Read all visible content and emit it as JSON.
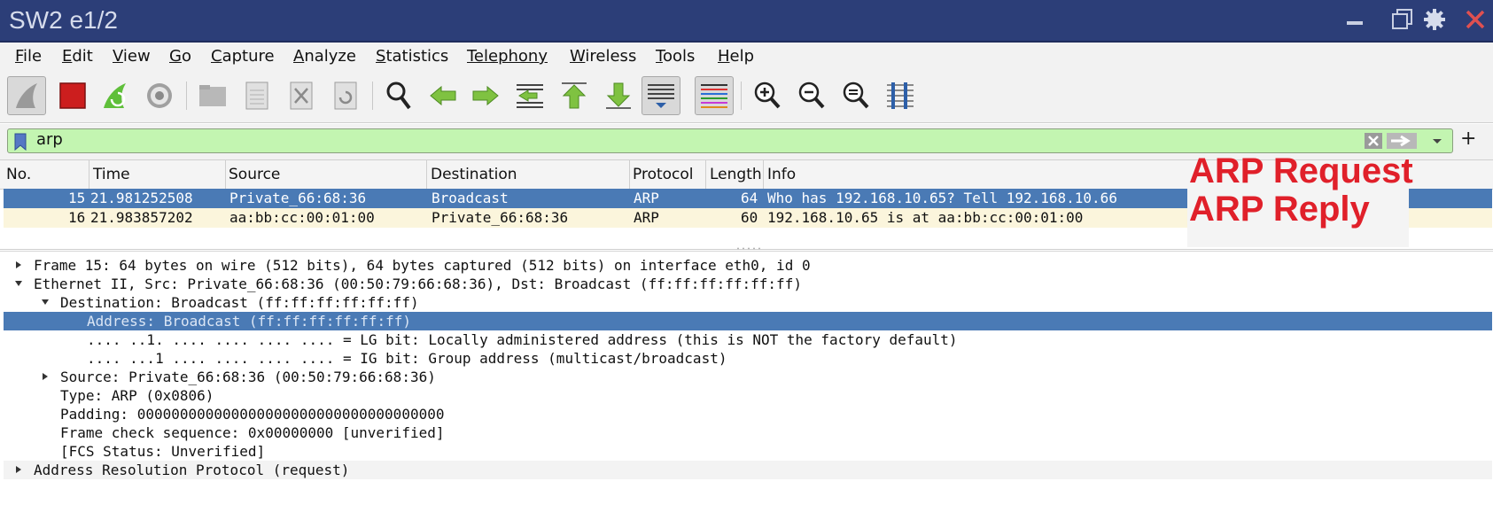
{
  "window": {
    "title": "SW2 e1/2"
  },
  "menu": [
    {
      "label": "File",
      "key": "F",
      "rest": "ile"
    },
    {
      "label": "Edit",
      "key": "E",
      "rest": "dit"
    },
    {
      "label": "View",
      "key": "V",
      "rest": "iew"
    },
    {
      "label": "Go",
      "key": "G",
      "rest": "o"
    },
    {
      "label": "Capture",
      "key": "C",
      "rest": "apture"
    },
    {
      "label": "Analyze",
      "key": "A",
      "rest": "nalyze"
    },
    {
      "label": "Statistics",
      "key": "S",
      "rest": "tatistics"
    },
    {
      "label": "Telephony",
      "key": "",
      "rest": "Telephony"
    },
    {
      "label": "Wireless",
      "key": "W",
      "rest": "ireless"
    },
    {
      "label": "Tools",
      "key": "T",
      "rest": "ools"
    },
    {
      "label": "Help",
      "key": "H",
      "rest": "elp"
    }
  ],
  "toolbar_icons": [
    "shark-fin-icon",
    "stop-icon",
    "restart-icon",
    "options-gear-icon",
    "open-folder-icon",
    "save-file-icon",
    "close-file-icon",
    "reload-icon",
    "find-icon",
    "go-back-icon",
    "go-forward-icon",
    "go-to-packet-icon",
    "first-packet-icon",
    "last-packet-icon",
    "autoscroll-icon",
    "colorize-icon",
    "zoom-in-icon",
    "zoom-out-icon",
    "zoom-normal-icon",
    "resize-columns-icon"
  ],
  "filter": {
    "value": "arp"
  },
  "columns": [
    "No.",
    "Time",
    "Source",
    "Destination",
    "Protocol",
    "Length",
    "Info"
  ],
  "packets": [
    {
      "no": "15",
      "time": "21.981252508",
      "source": "Private_66:68:36",
      "destination": "Broadcast",
      "protocol": "ARP",
      "length": "64",
      "info": "Who has 192.168.10.65? Tell 192.168.10.66"
    },
    {
      "no": "16",
      "time": "21.983857202",
      "source": "aa:bb:cc:00:01:00",
      "destination": "Private_66:68:36",
      "protocol": "ARP",
      "length": "60",
      "info": "192.168.10.65 is at aa:bb:cc:00:01:00"
    }
  ],
  "annotations": {
    "request": "ARP Request",
    "reply": "ARP Reply"
  },
  "details": [
    {
      "text": "Frame 15: 64 bytes on wire (512 bits), 64 bytes captured (512 bits) on interface eth0, id 0",
      "level": 0,
      "state": "collapsed"
    },
    {
      "text": "Ethernet II, Src: Private_66:68:36 (00:50:79:66:68:36), Dst: Broadcast (ff:ff:ff:ff:ff:ff)",
      "level": 0,
      "state": "expanded"
    },
    {
      "text": "Destination: Broadcast (ff:ff:ff:ff:ff:ff)",
      "level": 1,
      "state": "expanded"
    },
    {
      "text": "Address: Broadcast (ff:ff:ff:ff:ff:ff)",
      "level": 2,
      "state": "leaf",
      "selected": true
    },
    {
      "text": ".... ..1. .... .... .... .... = LG bit: Locally administered address (this is NOT the factory default)",
      "level": 2,
      "state": "leaf"
    },
    {
      "text": ".... ...1 .... .... .... .... = IG bit: Group address (multicast/broadcast)",
      "level": 2,
      "state": "leaf"
    },
    {
      "text": "Source: Private_66:68:36 (00:50:79:66:68:36)",
      "level": 1,
      "state": "collapsed"
    },
    {
      "text": "Type: ARP (0x0806)",
      "level": 1,
      "state": "leaf"
    },
    {
      "text": "Padding: 000000000000000000000000000000000000",
      "level": 1,
      "state": "leaf"
    },
    {
      "text": "Frame check sequence: 0x00000000 [unverified]",
      "level": 1,
      "state": "leaf"
    },
    {
      "text": "[FCS Status: Unverified]",
      "level": 1,
      "state": "leaf"
    },
    {
      "text": "Address Resolution Protocol (request)",
      "level": 0,
      "state": "collapsed",
      "shaded": true
    }
  ],
  "colors": {
    "titlebar": "#2c3e78",
    "filter_ok": "#c3f5b1",
    "selected_row": "#4a7ab5",
    "arp_row": "#fbf5dc",
    "annotation": "#e0202a"
  }
}
